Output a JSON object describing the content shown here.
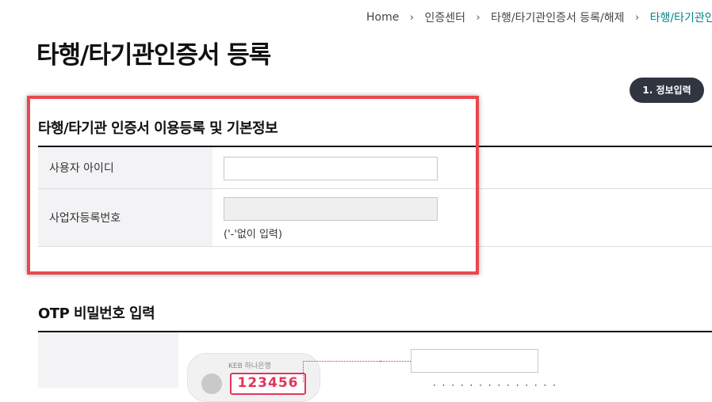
{
  "breadcrumb": {
    "items": [
      "Home",
      "인증센터",
      "타행/타기관인증서 등록/해제",
      "타행/타기관인증서 등록"
    ],
    "separator": "›"
  },
  "page": {
    "title": "타행/타기관인증서 등록"
  },
  "step": {
    "label": "1. 정보입력"
  },
  "section_basic": {
    "title": "타행/타기관 인증서 이용등록 및 기본정보",
    "rows": [
      {
        "label": "사용자 아이디",
        "value": ""
      },
      {
        "label": "사업자등록번호",
        "value": "",
        "hint": "('-'없이 입력)"
      }
    ]
  },
  "section_otp": {
    "title": "OTP 비밀번호 입력",
    "card_brand": "KEB 하나은행",
    "card_number": "123456",
    "input_value": "",
    "guide_text": "· · · · · · · · · · · · · ·"
  },
  "colors": {
    "accent": "#008485",
    "highlight": "#e8484d",
    "otp_number": "#e0365b",
    "badge_bg": "#2f3640"
  }
}
